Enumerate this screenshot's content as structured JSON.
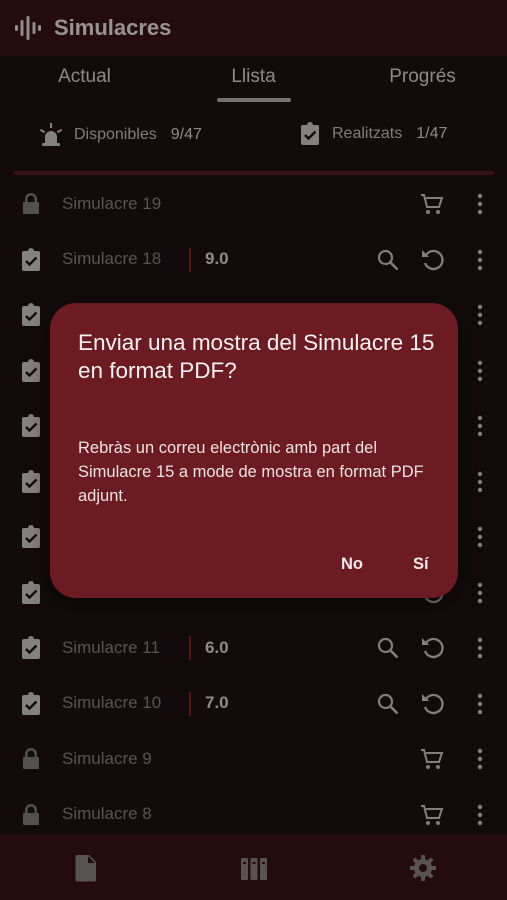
{
  "app": {
    "title": "Simulacres"
  },
  "tabs": [
    {
      "label": "Actual"
    },
    {
      "label": "Llista"
    },
    {
      "label": "Progrés"
    }
  ],
  "stats": {
    "available_label": "Disponibles",
    "available_value": "9/47",
    "done_label": "Realitzats",
    "done_value": "1/47"
  },
  "list": {
    "rows": [
      {
        "name": "Simulacre 19",
        "status": "locked",
        "score": ""
      },
      {
        "name": "Simulacre 18",
        "status": "done",
        "score": "9.0"
      },
      {
        "name": "",
        "status": "done",
        "score": ""
      },
      {
        "name": "",
        "status": "done",
        "score": ""
      },
      {
        "name": "",
        "status": "done",
        "score": ""
      },
      {
        "name": "",
        "status": "done",
        "score": ""
      },
      {
        "name": "",
        "status": "done",
        "score": ""
      },
      {
        "name": "",
        "status": "done",
        "score": ""
      },
      {
        "name": "Simulacre 11",
        "status": "done",
        "score": "6.0"
      },
      {
        "name": "Simulacre 10",
        "status": "done",
        "score": "7.0"
      },
      {
        "name": "Simulacre 9",
        "status": "locked",
        "score": ""
      },
      {
        "name": "Simulacre 8",
        "status": "locked",
        "score": ""
      }
    ]
  },
  "dialog": {
    "title": "Enviar una mostra del Simulacre 15 en format PDF?",
    "body": "Rebràs un correu electrònic amb part del Simulacre 15 a mode de mostra en format PDF adjunt.",
    "no_label": "No",
    "yes_label": "Sí"
  },
  "icons": {
    "logo": "waveform-icon",
    "available": "alarm-light-icon",
    "done": "clipboard-check-icon",
    "locked": "lock-icon",
    "buy": "cart-icon",
    "review": "search-icon",
    "retry": "retry-icon",
    "more": "more-vertical-icon",
    "nav": [
      "document-icon",
      "books-icon",
      "gear-icon"
    ]
  },
  "colors": {
    "appbar": "#3a1417",
    "background": "#1f1213",
    "dialog": "#6b1b21",
    "accent": "#8e2229"
  }
}
